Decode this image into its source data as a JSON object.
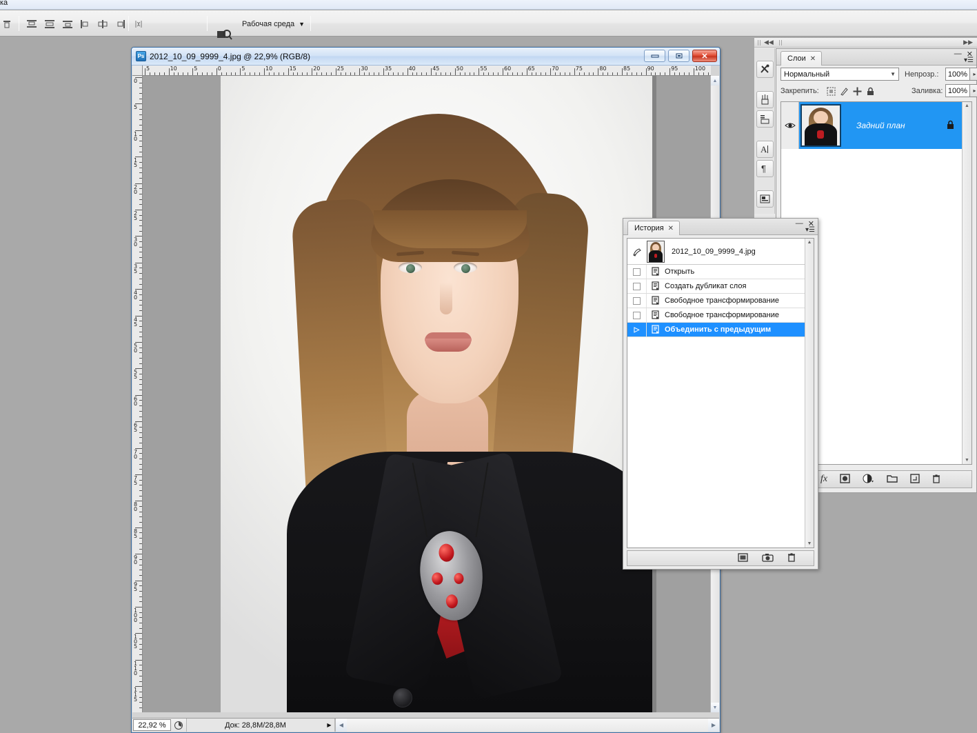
{
  "app": {
    "menu_fragment": "ка",
    "background_color": "#a9a9a9"
  },
  "options_bar": {
    "workspace_label": "Рабочая среда",
    "workspace_caret": "▼",
    "icons": [
      "align-top-edges-icon",
      "distribute-left-edges-icon",
      "distribute-vertical-centers-icon",
      "distribute-right-edges-icon",
      "align-left-edges-icon",
      "align-horizontal-centers-icon",
      "align-right-edges-icon",
      "auto-align-layers-icon",
      "screen-mode-icon"
    ]
  },
  "document": {
    "title": "2012_10_09_9999_4.jpg @ 22,9% (RGB/8)",
    "minimize_label": "▭",
    "restore_label": "❐",
    "close_label": "✕",
    "ruler_h_labels": [
      "5",
      "10",
      "5",
      "0",
      "5",
      "10",
      "15",
      "20",
      "25",
      "30",
      "35",
      "40",
      "45",
      "50",
      "55",
      "60",
      "65",
      "70",
      "75",
      "80",
      "85",
      "90",
      "95",
      "100"
    ],
    "ruler_v_labels": [
      "0",
      "5",
      "10",
      "15",
      "20",
      "25",
      "30",
      "35",
      "40",
      "45",
      "50",
      "55",
      "60",
      "65",
      "70",
      "75",
      "80",
      "85",
      "90",
      "95",
      "100",
      "105",
      "110",
      "115"
    ],
    "status": {
      "zoom": "22,92 %",
      "doc_info": "Док: 28,8M/28,8M",
      "expand_arrow": "▶",
      "scroll_left": "◀",
      "scroll_right": "▶"
    }
  },
  "dock": {
    "collapse_arrows": "◀◀",
    "expand_arrows": "▶▶",
    "tools": [
      {
        "name": "tool-preset-picker-icon",
        "glyph": "✂"
      },
      {
        "name": "brush-preset-icon",
        "glyph": "🖌"
      },
      {
        "name": "actions-icon",
        "glyph": "▤"
      },
      {
        "name": "character-panel-icon",
        "glyph": "A"
      },
      {
        "name": "paragraph-panel-icon",
        "glyph": "¶"
      },
      {
        "name": "layer-comps-icon",
        "glyph": "▣"
      }
    ]
  },
  "layers_panel": {
    "tab_label": "Слои",
    "tab_close": "✕",
    "minimize": "—",
    "close": "✕",
    "menu": "▾☰",
    "blend_mode": "Нормальный",
    "blend_caret": "▼",
    "opacity_label": "Непрозр.:",
    "opacity_value": "100%",
    "lock_label": "Закрепить:",
    "fill_label": "Заливка:",
    "fill_value": "100%",
    "lock_icons": [
      "lock-transparent-pixels-icon",
      "lock-image-pixels-icon",
      "lock-position-icon",
      "lock-all-icon"
    ],
    "layers": [
      {
        "name": "Задний план",
        "selected": true,
        "visible": true,
        "locked": true,
        "highlight_color": "#2196f3"
      }
    ],
    "footer_icons": [
      {
        "name": "link-layers-icon",
        "glyph": "⛓"
      },
      {
        "name": "layer-style-icon",
        "glyph": "fx"
      },
      {
        "name": "layer-mask-icon",
        "glyph": "▣"
      },
      {
        "name": "adjustment-layer-icon",
        "glyph": "◑"
      },
      {
        "name": "new-group-icon",
        "glyph": "▭"
      },
      {
        "name": "new-layer-icon",
        "glyph": "⊡"
      },
      {
        "name": "delete-layer-icon",
        "glyph": "🗑"
      }
    ]
  },
  "history_panel": {
    "tab_label": "История",
    "tab_close": "✕",
    "minimize": "—",
    "close": "✕",
    "menu": "▾☰",
    "snapshot": {
      "name": "2012_10_09_9999_4.jpg",
      "source_icon": "history-brush-source-icon"
    },
    "items": [
      {
        "label": "Открыть",
        "selected": false
      },
      {
        "label": "Создать дубликат слоя",
        "selected": false
      },
      {
        "label": "Свободное трансформирование",
        "selected": false
      },
      {
        "label": "Свободное трансформирование",
        "selected": false
      },
      {
        "label": "Объединить с предыдущим",
        "selected": true
      }
    ],
    "selected_color": "#1e90ff",
    "footer_icons": [
      {
        "name": "new-document-from-state-icon",
        "glyph": "▣"
      },
      {
        "name": "new-snapshot-icon",
        "glyph": "▨"
      },
      {
        "name": "delete-state-icon",
        "glyph": "🗑"
      }
    ]
  }
}
